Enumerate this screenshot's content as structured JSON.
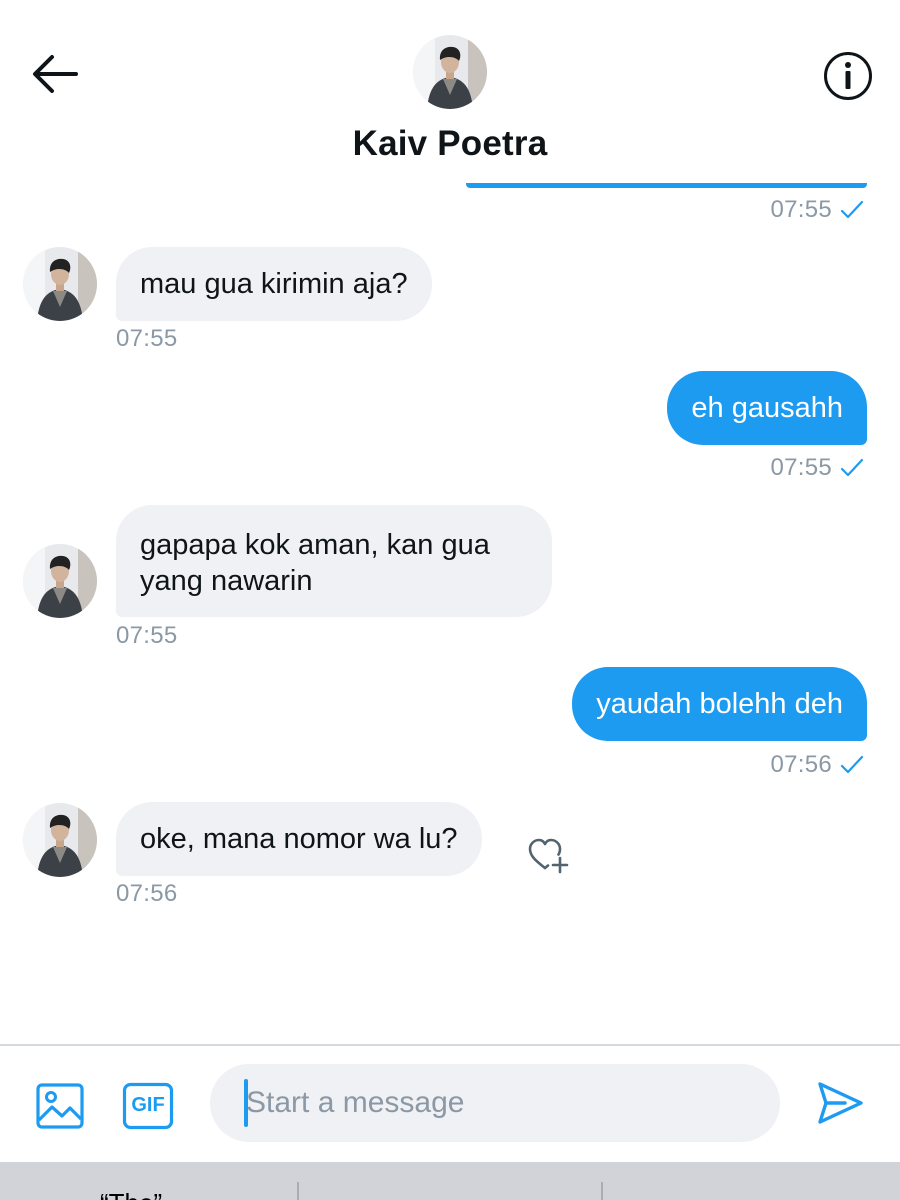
{
  "header": {
    "contact_name": "Kaiv Poetra",
    "back_icon": "arrow-left-icon",
    "info_icon": "info-circle-icon"
  },
  "colors": {
    "accent": "#1d9bf0",
    "incoming_bubble": "#eff1f4",
    "timestamp": "#8b98a5"
  },
  "messages": [
    {
      "direction": "outgoing",
      "text": "",
      "time": "07:55",
      "status": "sent"
    },
    {
      "direction": "incoming",
      "text": "mau gua kirimin aja?",
      "time": "07:55"
    },
    {
      "direction": "outgoing",
      "text": "eh gausahh",
      "time": "07:55",
      "status": "sent"
    },
    {
      "direction": "incoming",
      "text": "gapapa kok aman, kan gua yang nawarin",
      "line1": "gapapa kok aman, kan gua",
      "line2": "yang nawarin",
      "time": "07:55"
    },
    {
      "direction": "outgoing",
      "text": "yaudah bolehh deh",
      "time": "07:56",
      "status": "sent"
    },
    {
      "direction": "incoming",
      "text": "oke, mana nomor wa lu?",
      "time": "07:56"
    }
  ],
  "composer": {
    "placeholder": "Start a message",
    "media_icon": "image-icon",
    "gif_label": "GIF",
    "send_icon": "send-icon"
  },
  "keyboard_suggestions": [
    "“The”",
    "",
    ""
  ]
}
